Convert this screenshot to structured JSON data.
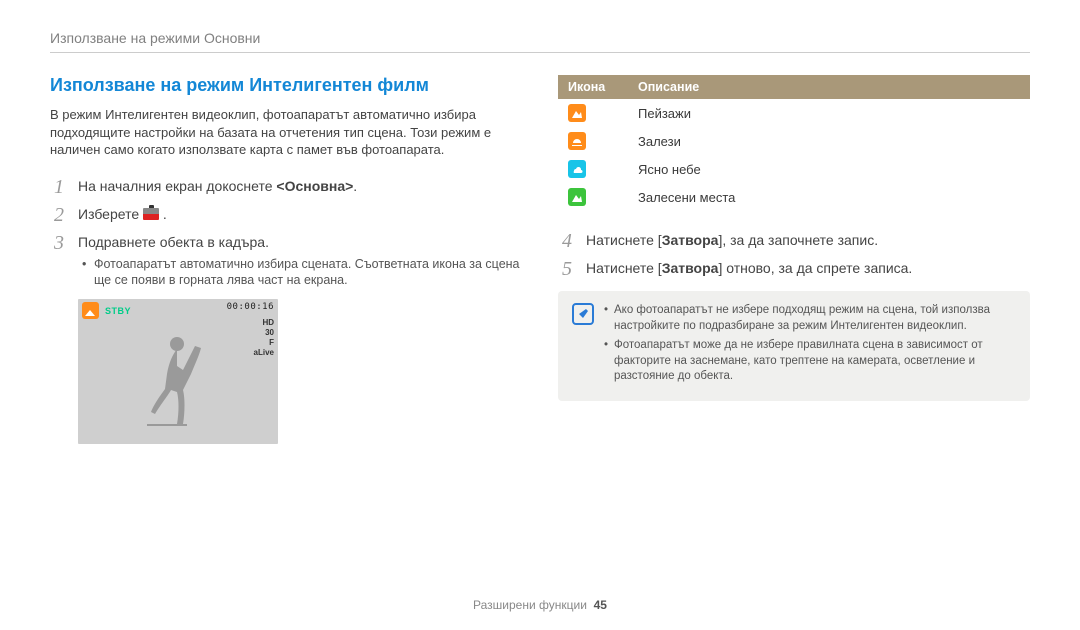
{
  "header": "Използване на режими Основни",
  "section_title": "Използване на режим Интелигентен филм",
  "intro": "В режим Интелигентен видеоклип, фотоапаратът автоматично избира подходящите настройки на базата на отчетения тип сцена. Този режим е наличен само когато използвате карта с памет във фотоапарата.",
  "steps": {
    "s1_pre": "На началния екран докоснете ",
    "s1_bold": "<Основна>",
    "s1_post": ".",
    "s2_pre": "Изберете ",
    "s2_post": ".",
    "s3": "Подравнете обекта в кадъра.",
    "s3_sub": "Фотоапаратът автоматично избира сцената. Съответната икона за сцена ще се появи в горната лява част на екрана.",
    "s4_pre": "Натиснете [",
    "s4_bold": "Затвора",
    "s4_post": "], за да започнете запис.",
    "s5_pre": "Натиснете [",
    "s5_bold": "Затвора",
    "s5_post": "] отново, за да спрете записа."
  },
  "preview": {
    "stby": "STBY",
    "timer": "00:00:16",
    "badges": [
      "HD",
      "30",
      "F",
      "aLive"
    ]
  },
  "table": {
    "head_icon": "Икона",
    "head_desc": "Описание",
    "rows": [
      {
        "desc": "Пейзажи",
        "color": "#ff8c1a",
        "shape": "mountain"
      },
      {
        "desc": "Залези",
        "color": "#ff8c1a",
        "shape": "sun"
      },
      {
        "desc": "Ясно небе",
        "color": "#18c4e8",
        "shape": "cloud"
      },
      {
        "desc": "Залесени места",
        "color": "#3cc43c",
        "shape": "mountain"
      }
    ]
  },
  "notes": [
    "Ако фотоапаратът не избере подходящ режим на сцена, той използва настройките по подразбиране за режим Интелигентен видеоклип.",
    "Фотоапаратът може да не избере правилната сцена в зависимост от факторите на заснемане, като трептене на камерата, осветление и разстояние до обекта."
  ],
  "footer": {
    "label": "Разширени функции",
    "page": "45"
  }
}
